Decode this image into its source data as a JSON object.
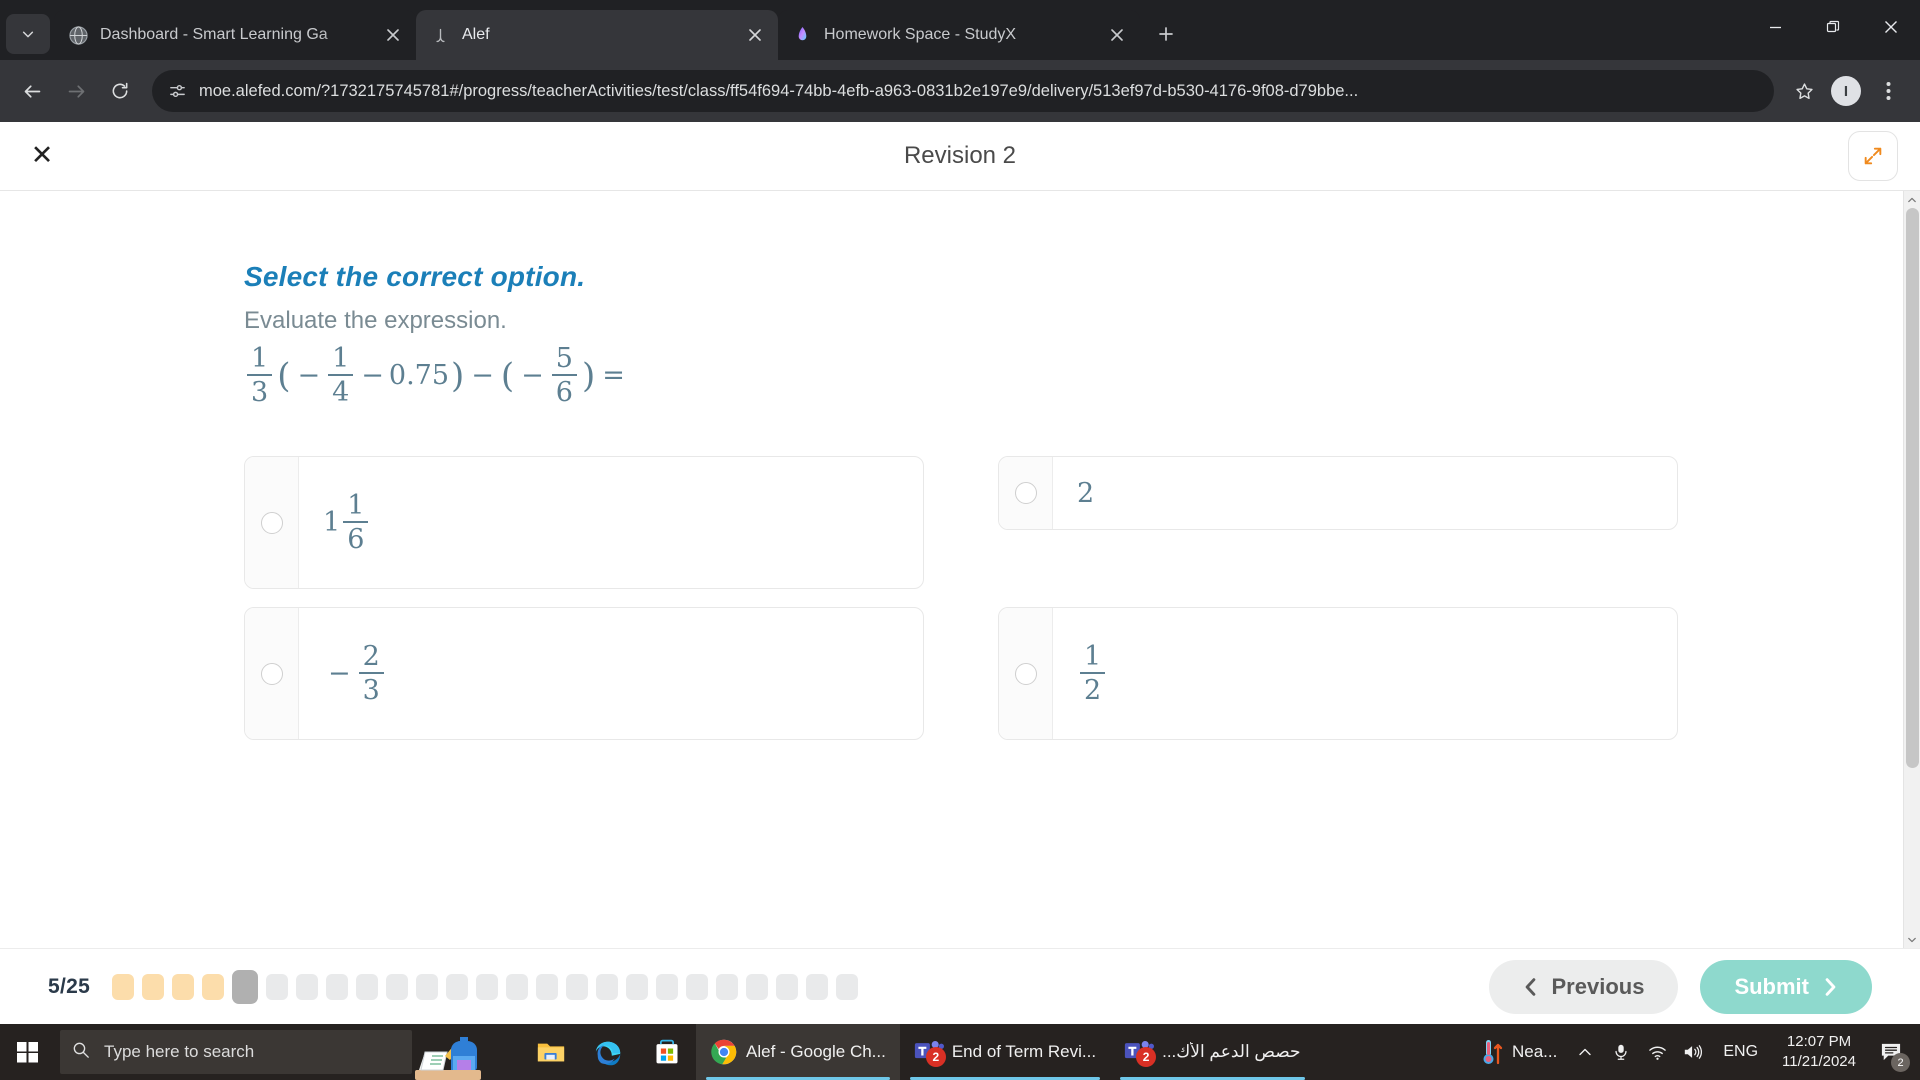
{
  "browser": {
    "tablist_icon": "chevron-down-icon",
    "tabs": [
      {
        "title": "Dashboard - Smart Learning Ga",
        "favicon": "globe-icon",
        "active": false
      },
      {
        "title": "Alef",
        "favicon": "alef-icon",
        "active": true
      },
      {
        "title": "Homework Space - StudyX",
        "favicon": "studyx-icon",
        "active": false
      }
    ],
    "new_tab_label": "+",
    "window_controls": {
      "minimize": "minimize-icon",
      "maximize": "restore-icon",
      "close": "close-icon"
    },
    "toolbar": {
      "back": "back-arrow-icon",
      "forward": "forward-arrow-icon",
      "reload": "reload-icon",
      "site_info": "site-settings-icon",
      "url": "moe.alefed.com/?1732175745781#/progress/teacherActivities/test/class/ff54f694-74bb-4efb-a963-0831b2e197e9/delivery/513ef97d-b530-4176-9f08-d79bbe...",
      "bookmark": "star-icon",
      "profile_initial": "I",
      "menu": "kebab-menu-icon"
    }
  },
  "app": {
    "close_label": "✕",
    "title": "Revision 2",
    "expand_icon": "expand-arrows-icon",
    "accent_orange": "#f08a1e",
    "accent_blue": "#1b7fb8",
    "accent_teal": "#8ed9cd"
  },
  "question": {
    "prompt": "Select the correct option.",
    "subtext": "Evaluate the expression.",
    "expression": {
      "lead_fraction": {
        "num": "1",
        "den": "3"
      },
      "open_paren": "(",
      "minus1": "−",
      "inner_fraction": {
        "num": "1",
        "den": "4"
      },
      "minus2": "−",
      "decimal": "0.75",
      "close_paren": ")",
      "minus3": "−",
      "open_paren2": "(",
      "minus4": "−",
      "second_fraction": {
        "num": "5",
        "den": "6"
      },
      "close_paren2": ")",
      "equals": "="
    },
    "options": [
      {
        "id": "a",
        "kind": "mixed",
        "whole": "1",
        "num": "1",
        "den": "6",
        "sign": "",
        "selected": false
      },
      {
        "id": "b",
        "kind": "plain",
        "text": "2",
        "selected": false
      },
      {
        "id": "c",
        "kind": "fraction",
        "sign": "−",
        "num": "2",
        "den": "3",
        "selected": false
      },
      {
        "id": "d",
        "kind": "fraction",
        "sign": "",
        "num": "1",
        "den": "2",
        "selected": false
      }
    ]
  },
  "footer": {
    "counter": "5/25",
    "total_questions": 25,
    "current_index": 5,
    "completed_count": 4,
    "previous_label": "Previous",
    "previous_icon": "chevron-left-icon",
    "submit_label": "Submit",
    "submit_icon": "chevron-right-icon",
    "pill_done_color": "#fcddab",
    "pill_current_color": "#b0b0b0",
    "pill_empty_color": "#e9eaeb"
  },
  "taskbar": {
    "start_icon": "windows-start-icon",
    "search_placeholder": "Type here to search",
    "search_icon": "search-icon",
    "widget_icon": "education-widget-icon",
    "pinned": [
      {
        "name": "file-explorer-icon"
      },
      {
        "name": "microsoft-edge-icon"
      },
      {
        "name": "microsoft-store-icon"
      }
    ],
    "tasks": [
      {
        "label": "Alef - Google Ch...",
        "icon": "chrome-icon",
        "badge": "",
        "active": true
      },
      {
        "label": "End of Term Revi...",
        "icon": "teams-icon",
        "badge": "2",
        "active": false
      },
      {
        "label": "حصص الدعم الأك...",
        "icon": "teams-icon",
        "badge": "2",
        "active": false
      }
    ],
    "tray": {
      "weather_label": "Nea...",
      "weather_icon": "thermometer-icon",
      "show_hidden_icon": "chevron-up-icon",
      "mic_icon": "microphone-icon",
      "network_icon": "wifi-icon",
      "volume_icon": "speaker-icon",
      "language": "ENG",
      "time": "12:07 PM",
      "date": "11/21/2024",
      "notifications_icon": "notification-icon",
      "notifications_count": "2"
    }
  }
}
